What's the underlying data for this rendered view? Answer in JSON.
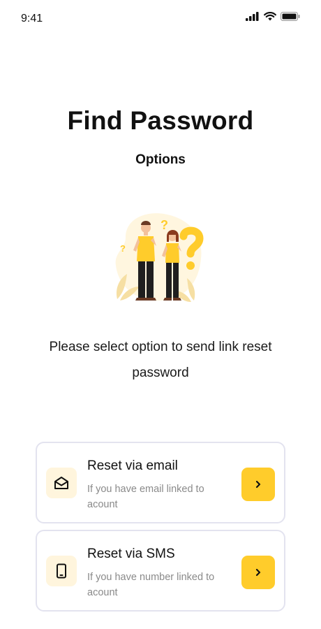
{
  "status_bar": {
    "time": "9:41",
    "icons": [
      "signal-icon",
      "wifi-icon",
      "battery-icon"
    ]
  },
  "page": {
    "title": "Find Password",
    "subtitle": "Options",
    "description": "Please select option to send link reset password",
    "illustration": "two-people-question-illustration"
  },
  "options": [
    {
      "title": "Reset via email",
      "description": "If you have email linked to acount",
      "icon": "envelope-icon",
      "action_icon": "chevron-right-icon"
    },
    {
      "title": "Reset via SMS",
      "description": "If you have number linked to acount",
      "icon": "phone-icon",
      "action_icon": "chevron-right-icon"
    }
  ],
  "colors": {
    "accent": "#ffcc2b",
    "icon_bg": "#fff5dd",
    "card_border": "#e3e3ef",
    "muted_text": "#8a8a8a"
  }
}
